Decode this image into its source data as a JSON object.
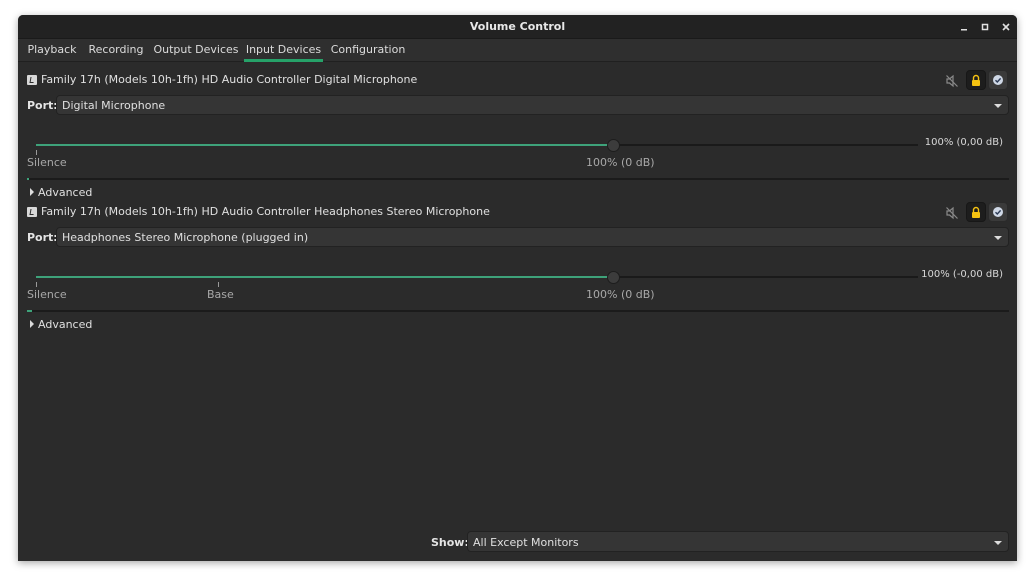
{
  "window": {
    "title": "Volume Control",
    "controls": [
      "minimize-icon",
      "maximize-icon",
      "close-icon"
    ]
  },
  "tabs": [
    {
      "label": "Playback",
      "active": false
    },
    {
      "label": "Recording",
      "active": false
    },
    {
      "label": "Output Devices",
      "active": false
    },
    {
      "label": "Input Devices",
      "active": true
    },
    {
      "label": "Configuration",
      "active": false
    }
  ],
  "devices": [
    {
      "name": "Family 17h (Models 10h-1fh) HD Audio Controller Digital Microphone",
      "port_label": "Port:",
      "port_value": "Digital Microphone",
      "volume_percent": 100,
      "volume_readout": "100% (0,00 dB)",
      "mark_silence": "Silence",
      "mark_100": "100% (0 dB)",
      "advanced_label": "Advanced",
      "muted": false,
      "locked": true
    },
    {
      "name": "Family 17h (Models 10h-1fh) HD Audio Controller Headphones Stereo Microphone",
      "port_label": "Port:",
      "port_value": "Headphones Stereo Microphone (plugged in)",
      "volume_percent": 100,
      "volume_readout": "100% (-0,00 dB)",
      "mark_silence": "Silence",
      "mark_base": "Base",
      "mark_100": "100% (0 dB)",
      "advanced_label": "Advanced",
      "muted": false,
      "locked": true
    }
  ],
  "footer": {
    "show_label": "Show:",
    "show_value": "All Except Monitors"
  },
  "colors": {
    "accent": "#26a269",
    "slider_fill": "#3ea27a",
    "lock": "#f5c211",
    "background": "#2b2b2b"
  }
}
